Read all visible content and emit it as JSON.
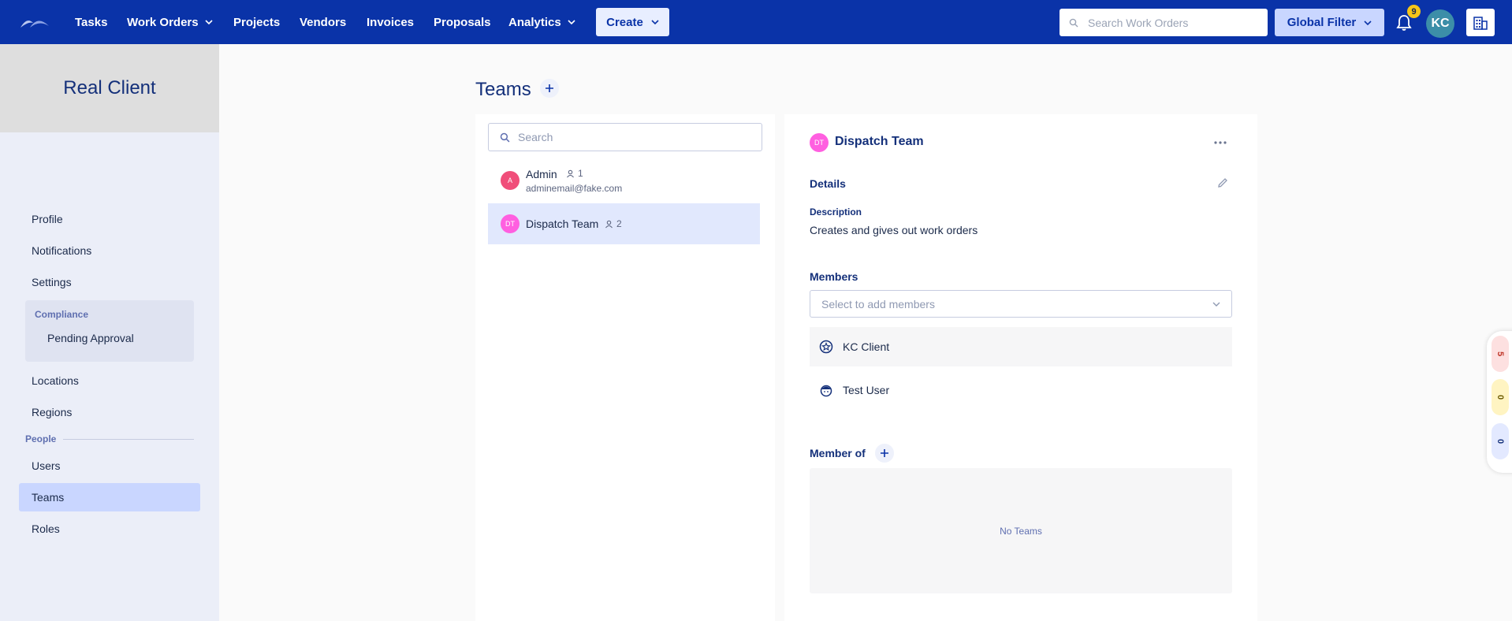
{
  "nav": {
    "items": [
      {
        "label": "Tasks",
        "dropdown": false
      },
      {
        "label": "Work Orders",
        "dropdown": true
      },
      {
        "label": "Projects",
        "dropdown": false
      },
      {
        "label": "Vendors",
        "dropdown": false
      },
      {
        "label": "Invoices",
        "dropdown": false
      },
      {
        "label": "Proposals",
        "dropdown": false
      },
      {
        "label": "Analytics",
        "dropdown": true
      }
    ],
    "create_label": "Create",
    "search_placeholder": "Search Work Orders",
    "global_filter_label": "Global Filter",
    "notification_count": "9",
    "user_initials": "KC"
  },
  "sidebar": {
    "client_name": "Real Client",
    "links": {
      "profile": "Profile",
      "notifications": "Notifications",
      "settings": "Settings",
      "compliance": "Compliance",
      "pending_approval": "Pending Approval",
      "locations": "Locations",
      "regions": "Regions",
      "people": "People",
      "users": "Users",
      "teams": "Teams",
      "roles": "Roles"
    }
  },
  "teams": {
    "title": "Teams",
    "search_placeholder": "Search",
    "list": [
      {
        "initials": "A",
        "name": "Admin",
        "count": "1",
        "email": "adminemail@fake.com",
        "color": "#f04e7a"
      },
      {
        "initials": "DT",
        "name": "Dispatch Team",
        "count": "2",
        "email": "",
        "color": "#ff5fe0"
      }
    ]
  },
  "detail": {
    "initials": "DT",
    "name": "Dispatch Team",
    "details_heading": "Details",
    "description_label": "Description",
    "description": "Creates and gives out work orders",
    "members_heading": "Members",
    "members_placeholder": "Select to add members",
    "members": [
      {
        "name": "KC Client",
        "icon": "star-badge-icon"
      },
      {
        "name": "Test User",
        "icon": "hardhat-user-icon"
      }
    ],
    "member_of_heading": "Member of",
    "no_teams": "No Teams"
  },
  "edge_counters": [
    {
      "value": "5",
      "color": "#fde0e0",
      "text_color": "#c0392b"
    },
    {
      "value": "0",
      "color": "#fff4c2",
      "text_color": "#6b5a00"
    },
    {
      "value": "0",
      "color": "#e3e9ff",
      "text_color": "#14307a"
    }
  ],
  "colors": {
    "brand": "#0a33a8",
    "accent_light": "#c9d6ff"
  }
}
